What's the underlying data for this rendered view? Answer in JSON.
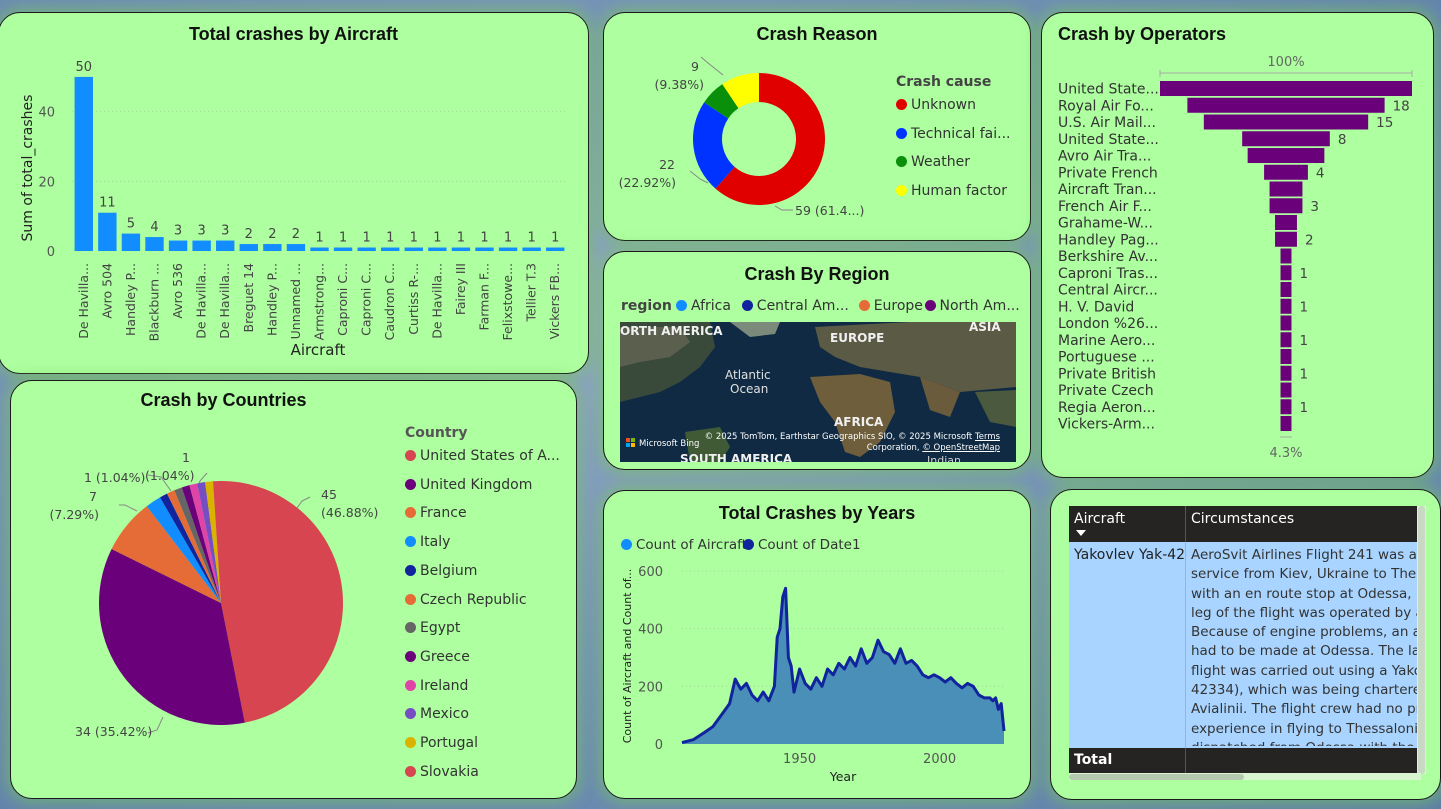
{
  "colors": {
    "card_bg": "#adff9f",
    "bar_blue": "#118dff",
    "purple": "#6b007b"
  },
  "aircraft_card": {
    "title": "Total crashes by Aircraft",
    "chart_data": {
      "type": "bar",
      "title": "Total crashes by Aircraft",
      "xlabel": "Aircraft",
      "ylabel": "Sum of total_crashes",
      "yticks": [
        "0",
        "20",
        "40"
      ],
      "ylim": [
        0,
        54
      ],
      "categories": [
        "De Havilla...",
        "Avro 504",
        "Handley P...",
        "Blackburn ...",
        "Avro 536",
        "De Havilla...",
        "De Havilla...",
        "Breguet 14",
        "Handley P...",
        "Unnamed ...",
        "Armstrong...",
        "Caproni C...",
        "Caproni C...",
        "Caudron C...",
        "Curtiss R-...",
        "De Havilla...",
        "Fairey III",
        "Farman F...",
        "Felixstowe...",
        "Tellier T.3",
        "Vickers FB..."
      ],
      "values": [
        50,
        11,
        5,
        4,
        3,
        3,
        3,
        2,
        2,
        2,
        1,
        1,
        1,
        1,
        1,
        1,
        1,
        1,
        1,
        1,
        1
      ]
    }
  },
  "reason_card": {
    "title": "Crash Reason",
    "legend_title": "Crash cause",
    "chart_data": {
      "type": "pie",
      "title": "Crash Reason",
      "slices": [
        {
          "label": "Unknown",
          "value": 59,
          "color": "#e00000",
          "data_label": "59 (61.4...)"
        },
        {
          "label": "Technical fai...",
          "value": 22,
          "color": "#0033ff",
          "data_label": "22\n(22.92%)"
        },
        {
          "label": "Weather",
          "value": 6,
          "color": "#0a8f0a",
          "data_label": ""
        },
        {
          "label": "Human factor",
          "value": 9,
          "color": "#ffff00",
          "data_label": "9\n(9.38%)"
        }
      ]
    },
    "labels": {
      "l59": "59 (61.4...)",
      "l22a": "22",
      "l22b": "(22.92%)",
      "l9a": "9",
      "l9b": "(9.38%)"
    }
  },
  "operators_card": {
    "title": "Crash by Operators",
    "top_pct": "100%",
    "bottom_pct": "4.3%",
    "chart_data": {
      "type": "bar",
      "title": "Crash by Operators",
      "categories": [
        "United State...",
        "Royal Air Fo...",
        "U.S. Air Mail...",
        "United State...",
        "Avro Air Tra...",
        "Private French",
        "Aircraft Tran...",
        "French Air F...",
        "Grahame-W...",
        "Handley Pag...",
        "Berkshire Av...",
        "Caproni Tras...",
        "Central Aircr...",
        "H. V. David",
        "London %26...",
        "Marine Aero...",
        "Portuguese ...",
        "Private British",
        "Private Czech",
        "Regia Aeron...",
        "Vickers-Arm..."
      ],
      "values": [
        23,
        18,
        15,
        8,
        7,
        4,
        3,
        3,
        2,
        2,
        1,
        1,
        1,
        1,
        1,
        1,
        1,
        1,
        1,
        1,
        1
      ],
      "data_labels": [
        "",
        "18",
        "15",
        "8",
        "",
        "4",
        "",
        "3",
        "",
        "2",
        "",
        "1",
        "",
        "1",
        "",
        "1",
        "",
        "1",
        "",
        "1",
        ""
      ]
    }
  },
  "region_card": {
    "title": "Crash By Region",
    "legend_title": "region",
    "legend": [
      {
        "label": "Africa",
        "color": "#118dff"
      },
      {
        "label": "Central Am...",
        "color": "#12239e"
      },
      {
        "label": "Europe",
        "color": "#e66c37"
      },
      {
        "label": "North Am...",
        "color": "#6b007b"
      }
    ],
    "map_labels": {
      "north_america": "ORTH AMERICA",
      "europe": "EUROPE",
      "asia": "ASIA",
      "ocean1": "Atlantic",
      "ocean2": "Ocean",
      "africa": "AFRICA",
      "south_america": "SOUTH AMERICA",
      "indian": "Indian"
    },
    "bing": "Microsoft Bing",
    "attribution1": "© 2025 TomTom, Earthstar Geographics SIO, © 2025 Microsoft",
    "terms": "Terms",
    "attribution2": "Corporation, ",
    "osm": "© OpenStreetMap"
  },
  "countries_card": {
    "title": "Crash by Countries",
    "legend_title": "Country",
    "chart_data": {
      "type": "pie",
      "title": "Crash by Countries",
      "slices": [
        {
          "label": "United States of A...",
          "value": 45,
          "color": "#d64550"
        },
        {
          "label": "United Kingdom",
          "value": 34,
          "color": "#6b007b"
        },
        {
          "label": "France",
          "value": 7,
          "color": "#e66c37"
        },
        {
          "label": "Italy",
          "value": 2,
          "color": "#118dff"
        },
        {
          "label": "Belgium",
          "value": 1,
          "color": "#12239e"
        },
        {
          "label": "Czech Republic",
          "value": 1,
          "color": "#e66c37"
        },
        {
          "label": "Egypt",
          "value": 1,
          "color": "#666666"
        },
        {
          "label": "Greece",
          "value": 1,
          "color": "#6b007b"
        },
        {
          "label": "Ireland",
          "value": 1,
          "color": "#e044a7"
        },
        {
          "label": "Mexico",
          "value": 1,
          "color": "#744ec2"
        },
        {
          "label": "Portugal",
          "value": 1,
          "color": "#d9b300"
        },
        {
          "label": "Slovakia",
          "value": 1,
          "color": "#d64550"
        }
      ]
    },
    "labels": {
      "l45a": "45",
      "l45b": "(46.88%)",
      "l34": "34 (35.42%)",
      "l7a": "7",
      "l7b": "(7.29%)",
      "l1a": "1 (1.04%)",
      "l1b": "(1.04%)",
      "l1c": "1"
    }
  },
  "years_card": {
    "title": "Total Crashes by Years",
    "legend": [
      {
        "label": "Count of Aircraft",
        "color": "#118dff"
      },
      {
        "label": "Count of Date1",
        "color": "#12239e"
      }
    ],
    "chart_data": {
      "type": "area",
      "title": "Total Crashes by Years",
      "xlabel": "Year",
      "ylabel": "Count of Aircraft and Count of...",
      "xticks": [
        "1950",
        "2000"
      ],
      "yticks": [
        "0",
        "200",
        "400",
        "600"
      ],
      "xlim": [
        1908,
        2023
      ],
      "ylim": [
        0,
        600
      ],
      "x": [
        1908,
        1912,
        1916,
        1919,
        1922,
        1925,
        1927,
        1929,
        1931,
        1933,
        1935,
        1937,
        1939,
        1941,
        1942,
        1943,
        1944,
        1945,
        1946,
        1947,
        1948,
        1950,
        1952,
        1954,
        1956,
        1958,
        1960,
        1962,
        1964,
        1966,
        1968,
        1970,
        1972,
        1974,
        1976,
        1978,
        1980,
        1982,
        1984,
        1986,
        1988,
        1990,
        1992,
        1994,
        1996,
        1998,
        2000,
        2002,
        2004,
        2006,
        2008,
        2010,
        2012,
        2014,
        2016,
        2018,
        2019,
        2020,
        2021,
        2022,
        2023
      ],
      "y": [
        5,
        15,
        40,
        60,
        100,
        140,
        225,
        190,
        210,
        170,
        150,
        180,
        150,
        200,
        370,
        400,
        510,
        540,
        300,
        270,
        180,
        260,
        210,
        190,
        230,
        200,
        260,
        240,
        280,
        260,
        300,
        270,
        330,
        280,
        300,
        360,
        320,
        310,
        280,
        330,
        280,
        290,
        270,
        240,
        230,
        240,
        230,
        215,
        230,
        210,
        195,
        210,
        200,
        170,
        160,
        160,
        150,
        160,
        120,
        140,
        45
      ]
    }
  },
  "table_card": {
    "columns": [
      "Aircraft",
      "Circumstances"
    ],
    "row_aircraft": "Yakovlev Yak-42",
    "row_circumstances": "AeroSvit Airlines Flight 241 was a s\nservice from Kiev, Ukraine to Thess\nwith an en route stop at Odessa, U\nleg of the flight was operated by a\nBecause of engine problems, an ai\nhad to be made at Odessa. The las\nflight was carried out using a Yako\n42334), which was being charterec\nAvialinii. The flight crew had no pr\nexperience in flying to Thessalonik\ndispatched from Odessa with the l",
    "total_label": "Total"
  }
}
